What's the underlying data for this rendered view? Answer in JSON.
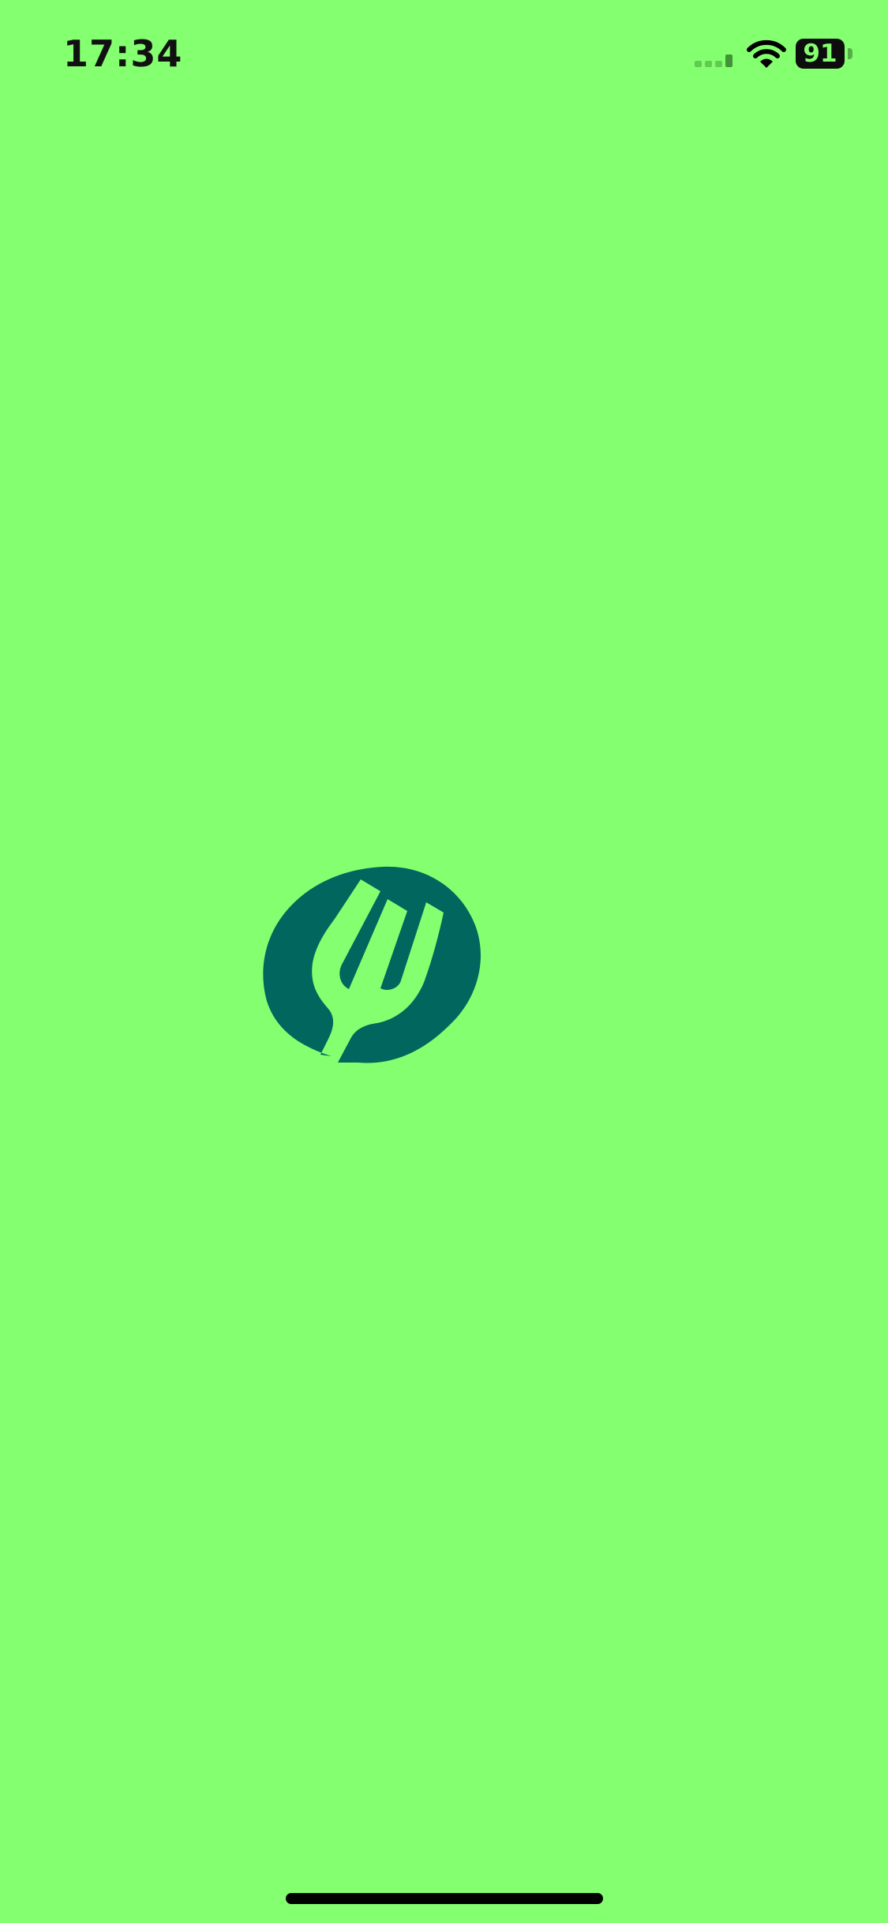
{
  "status_bar": {
    "time": "17:34",
    "battery_level": "91",
    "signal_icon": "cellular-signal-icon",
    "wifi_icon": "wifi-icon"
  },
  "splash": {
    "logo_icon": "fork-logo-icon"
  },
  "colors": {
    "background": "#84FF6F",
    "logo": "#00665E",
    "status_text": "#111111"
  }
}
